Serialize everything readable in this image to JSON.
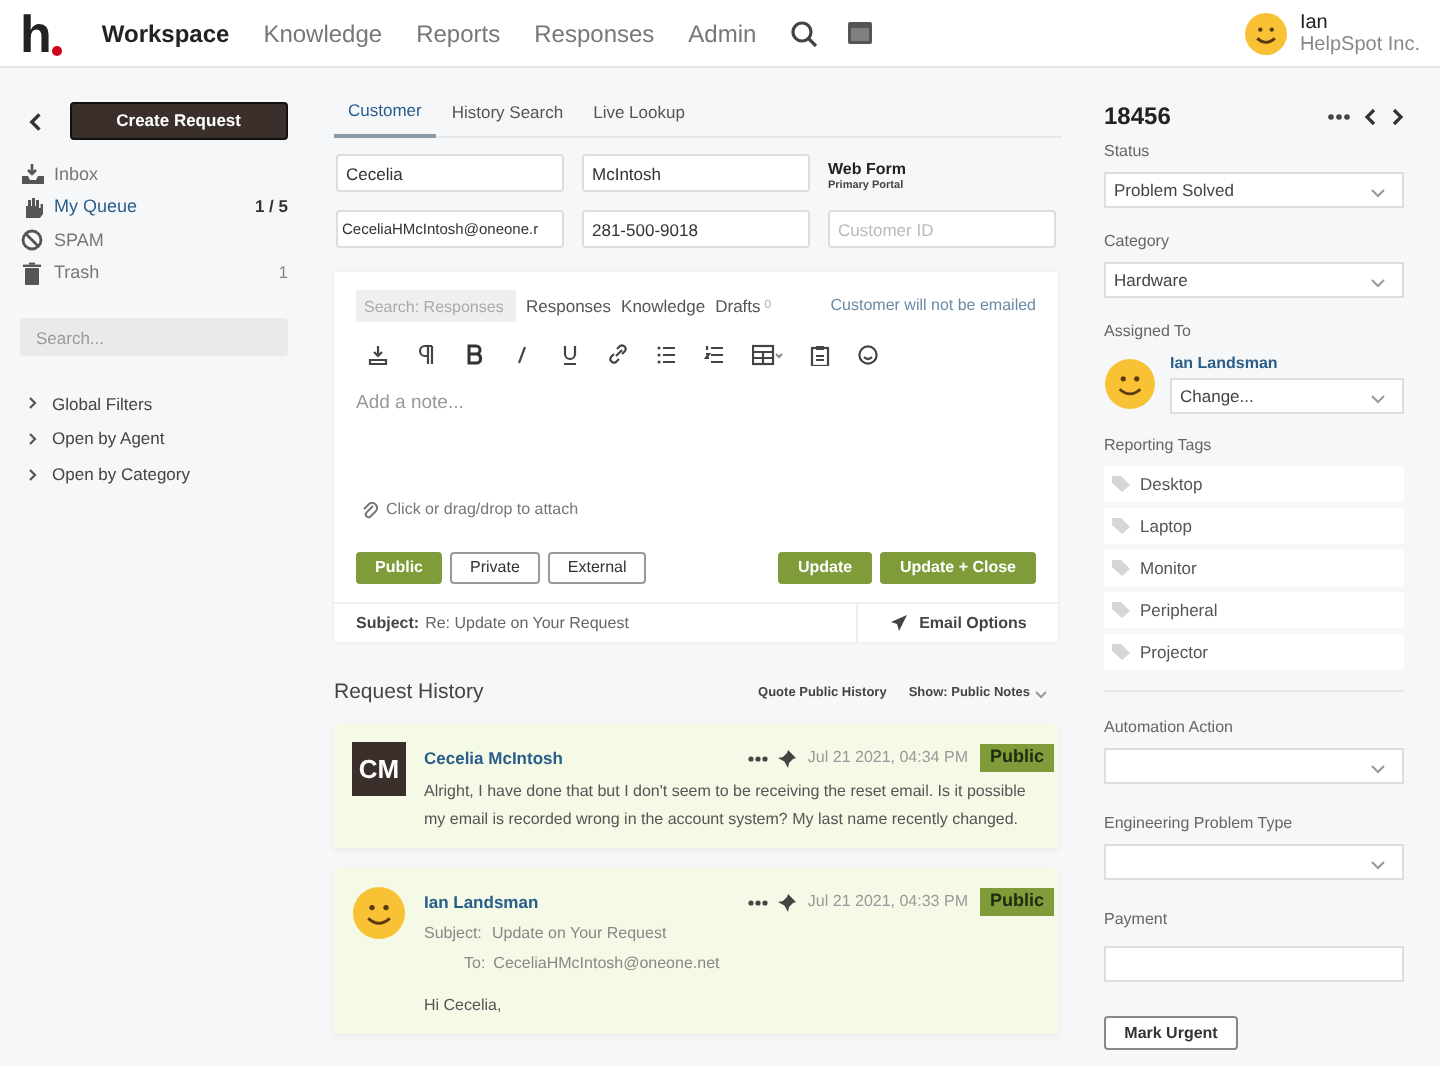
{
  "nav": {
    "logo": "h",
    "items": [
      {
        "label": "Workspace",
        "selected": true
      },
      {
        "label": "Knowledge",
        "selected": false
      },
      {
        "label": "Reports",
        "selected": false
      },
      {
        "label": "Responses",
        "selected": false
      },
      {
        "label": "Admin",
        "selected": false
      }
    ],
    "user": {
      "name": "Ian",
      "org": "HelpSpot Inc."
    }
  },
  "sidebar": {
    "create_button": "Create Request",
    "items": [
      {
        "label": "Inbox",
        "selected": false
      },
      {
        "label": "My Queue",
        "count": "1 / 5",
        "selected": true
      },
      {
        "label": "SPAM",
        "selected": false
      },
      {
        "label": "Trash",
        "count": "1",
        "selected": false
      }
    ],
    "search": {
      "placeholder": "Search..."
    },
    "filters": [
      "Global Filters",
      "Open by Agent",
      "Open by Category"
    ]
  },
  "customer": {
    "tabs": [
      {
        "label": "Customer",
        "selected": true
      },
      {
        "label": "History Search",
        "selected": false
      },
      {
        "label": "Live Lookup",
        "selected": false
      }
    ],
    "first_name": "Cecelia",
    "last_name": "McIntosh",
    "source": "Web Form",
    "portal": "Primary Portal",
    "email": "CeceliaHMcIntosh@oneone.r",
    "phone": "281-500-9018",
    "customer_id": {
      "placeholder": "Customer ID"
    }
  },
  "editor": {
    "search": {
      "placeholder": "Search: Responses"
    },
    "links": [
      "Responses",
      "Knowledge",
      "Drafts"
    ],
    "drafts_count": "0",
    "notice": "Customer will not be emailed",
    "note": {
      "placeholder": "Add a note..."
    },
    "attach": "Click or drag/drop to attach",
    "visibility": [
      {
        "label": "Public",
        "selected": true
      },
      {
        "label": "Private",
        "selected": false
      },
      {
        "label": "External",
        "selected": false
      }
    ],
    "actions": [
      "Update",
      "Update + Close"
    ],
    "subject_label": "Subject:",
    "subject": "Re: Update on Your Request",
    "email_options": "Email Options"
  },
  "history": {
    "title": "Request History",
    "quote": "Quote Public History",
    "show": "Show: Public Notes",
    "entries": [
      {
        "kind": "initials",
        "initials": "CM",
        "author": "Cecelia McIntosh",
        "time": "Jul 21 2021, 04:34 PM",
        "badge": "Public",
        "body": "Alright, I have done that but I don't seem to be receiving the reset email. Is it possible my email is recorded wrong in the account system? My last name recently changed."
      },
      {
        "kind": "emoji",
        "author": "Ian Landsman",
        "time": "Jul 21 2021, 04:33 PM",
        "badge": "Public",
        "subject_label": "Subject:",
        "subject": "Update on Your Request",
        "to_label": "To:",
        "to": "CeceliaHMcIntosh@oneone.net",
        "body": "Hi Cecelia,"
      }
    ]
  },
  "details": {
    "id": "18456",
    "status": {
      "label": "Status",
      "value": "Problem Solved"
    },
    "category": {
      "label": "Category",
      "value": "Hardware"
    },
    "assigned": {
      "label": "Assigned To",
      "name": "Ian Landsman",
      "value": "Change..."
    },
    "tags_label": "Reporting Tags",
    "tags": [
      {
        "label": "Desktop",
        "selected": false
      },
      {
        "label": "Laptop",
        "selected": false
      },
      {
        "label": "Monitor",
        "selected": false
      },
      {
        "label": "Peripheral",
        "selected": false
      },
      {
        "label": "Projector",
        "selected": false
      }
    ],
    "automation": {
      "label": "Automation Action"
    },
    "engineering": {
      "label": "Engineering Problem Type"
    },
    "payment": {
      "label": "Payment"
    },
    "urgent_button": "Mark Urgent"
  }
}
